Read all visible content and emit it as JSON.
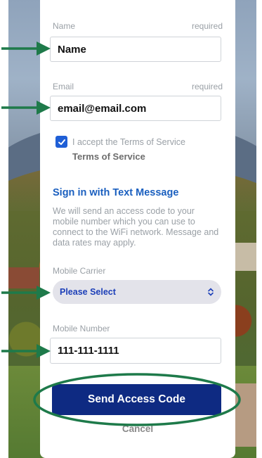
{
  "form": {
    "name": {
      "label": "Name",
      "required": "required",
      "value": "Name"
    },
    "email": {
      "label": "Email",
      "required": "required",
      "value": "email@email.com"
    },
    "terms": {
      "checked": true,
      "text": "I accept the Terms of Service",
      "link": "Terms of Service"
    },
    "sms": {
      "title": "Sign in with Text Message",
      "description": "We will send an access code to your mobile number which you can use to connect to the WiFi network. Message and data rates may apply."
    },
    "carrier": {
      "label": "Mobile Carrier",
      "selected": "Please Select"
    },
    "mobile": {
      "label": "Mobile Number",
      "value": "111-111-1111"
    },
    "send_label": "Send Access Code",
    "cancel_label": "Cancel"
  },
  "colors": {
    "annotation": "#1e7a4a",
    "button": "#0e2a82",
    "link": "#1a5fbf",
    "checkbox": "#1f5fd6"
  },
  "icons": {
    "checkbox": "check-icon",
    "select": "updown-chevron-icon",
    "annotation": "arrow-right-icon"
  }
}
